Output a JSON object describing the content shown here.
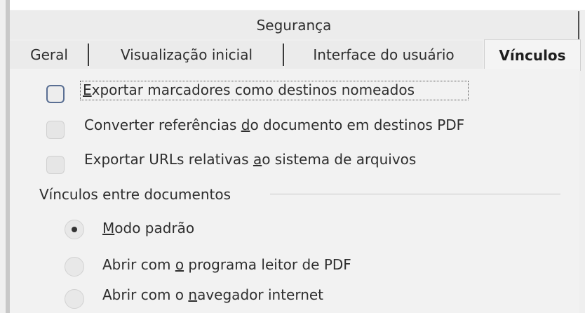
{
  "tabs": {
    "top_row": [
      "Segurança"
    ],
    "bottom_row": [
      "Geral",
      "Visualização inicial",
      "Interface do usuário",
      "Vínculos"
    ],
    "active": "Vínculos"
  },
  "options": {
    "checkboxes": [
      {
        "pre": "",
        "mnemonic": "E",
        "post": "xportar marcadores como destinos nomeados",
        "checked": false,
        "focused": true
      },
      {
        "pre": "Converter referências ",
        "mnemonic": "d",
        "post": "o documento em destinos PDF",
        "checked": false,
        "focused": false
      },
      {
        "pre": "Exportar URLs relativas ",
        "mnemonic": "a",
        "post": "o sistema de arquivos",
        "checked": false,
        "focused": false
      }
    ]
  },
  "cross_doc_group": {
    "title": "Vínculos entre documentos",
    "radios": [
      {
        "pre": "",
        "mnemonic": "M",
        "post": "odo padrão",
        "checked": true
      },
      {
        "pre": "Abrir com ",
        "mnemonic": "o",
        "post": " programa leitor de PDF",
        "checked": false
      },
      {
        "pre": "Abrir com o ",
        "mnemonic": "n",
        "post": "avegador internet",
        "checked": false
      }
    ]
  }
}
